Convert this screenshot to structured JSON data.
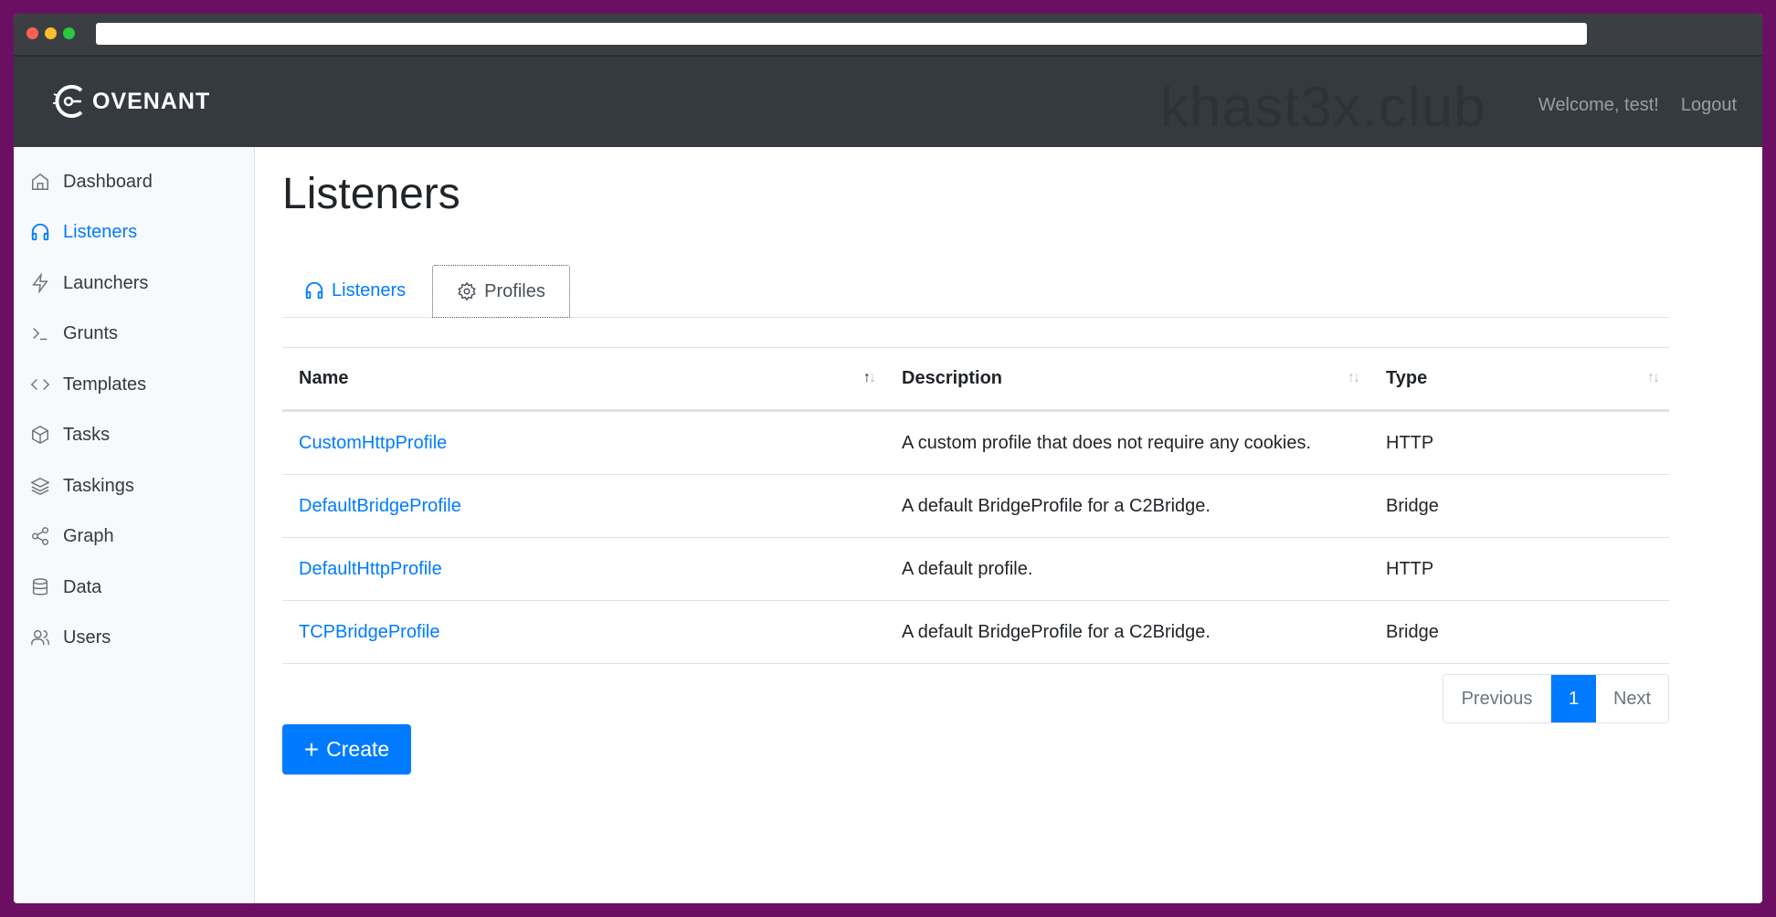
{
  "header": {
    "logo_text": "OVENANT",
    "watermark": "khast3x.club",
    "welcome": "Welcome, test!",
    "logout": "Logout"
  },
  "sidebar": {
    "items": [
      {
        "label": "Dashboard",
        "icon": "home-icon"
      },
      {
        "label": "Listeners",
        "icon": "headphones-icon",
        "active": true
      },
      {
        "label": "Launchers",
        "icon": "bolt-icon"
      },
      {
        "label": "Grunts",
        "icon": "terminal-icon"
      },
      {
        "label": "Templates",
        "icon": "code-icon"
      },
      {
        "label": "Tasks",
        "icon": "box-icon"
      },
      {
        "label": "Taskings",
        "icon": "layers-icon"
      },
      {
        "label": "Graph",
        "icon": "share-icon"
      },
      {
        "label": "Data",
        "icon": "database-icon"
      },
      {
        "label": "Users",
        "icon": "users-icon"
      }
    ]
  },
  "main": {
    "title": "Listeners",
    "tabs": [
      {
        "label": "Listeners",
        "icon": "headphones-icon"
      },
      {
        "label": "Profiles",
        "icon": "gear-icon",
        "selected": true
      }
    ],
    "table": {
      "columns": [
        "Name",
        "Description",
        "Type"
      ],
      "rows": [
        {
          "name": "CustomHttpProfile",
          "description": "A custom profile that does not require any cookies.",
          "type": "HTTP"
        },
        {
          "name": "DefaultBridgeProfile",
          "description": "A default BridgeProfile for a C2Bridge.",
          "type": "Bridge"
        },
        {
          "name": "DefaultHttpProfile",
          "description": "A default profile.",
          "type": "HTTP"
        },
        {
          "name": "TCPBridgeProfile",
          "description": "A default BridgeProfile for a C2Bridge.",
          "type": "Bridge"
        }
      ]
    },
    "pagination": {
      "previous": "Previous",
      "current": "1",
      "next": "Next"
    },
    "create_label": "Create"
  },
  "colors": {
    "accent": "#007bff",
    "navbar": "#343a40",
    "sidebar": "#f8f9fa",
    "frame": "#6b0f63"
  }
}
